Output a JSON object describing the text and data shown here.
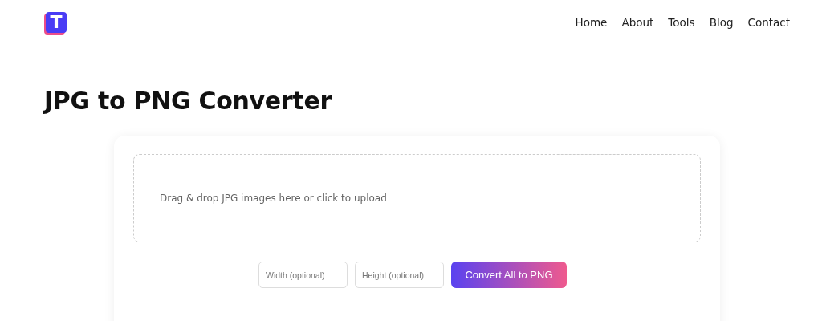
{
  "logo": {
    "letter": "T"
  },
  "nav": [
    "Home",
    "About",
    "Tools",
    "Blog",
    "Contact"
  ],
  "title": "JPG to PNG Converter",
  "dropzone": {
    "text": "Drag & drop JPG images here or click to upload"
  },
  "width_field": {
    "placeholder": "Width (optional)"
  },
  "height_field": {
    "placeholder": "Height (optional)"
  },
  "convert_button": "Convert All to PNG"
}
